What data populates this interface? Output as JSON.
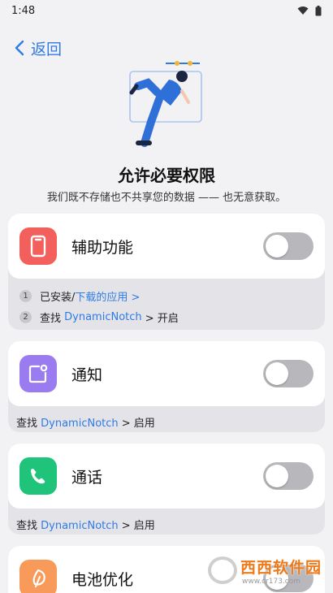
{
  "status": {
    "time": "1:48"
  },
  "nav": {
    "back_label": "返回"
  },
  "header": {
    "title": "允许必要权限",
    "subtitle": "我们既不存储也不共享您的数据 —— 也无意获取。"
  },
  "accessibility": {
    "label": "辅助功能",
    "enabled": false,
    "steps": [
      {
        "num": "1",
        "prefix": "已安装/",
        "link": "下载的应用 >",
        "suffix": ""
      },
      {
        "num": "2",
        "prefix": "查找 ",
        "link": "DynamicNotch",
        "suffix": " > 开启"
      }
    ]
  },
  "notification": {
    "label": "通知",
    "enabled": false,
    "hint": {
      "prefix": "查找 ",
      "link": "DynamicNotch",
      "suffix": " > 启用"
    }
  },
  "call": {
    "label": "通话",
    "enabled": false,
    "hint": {
      "prefix": "查找 ",
      "link": "DynamicNotch",
      "suffix": " > 启用"
    }
  },
  "battery": {
    "label": "电池优化",
    "enabled": false
  },
  "watermark": {
    "text": "西西软件园",
    "sub": "www.cr173.com"
  },
  "colors": {
    "accent": "#2f7be5",
    "accessibility_icon": "#f25f5c",
    "notification_icon": "#9b7cf0",
    "call_icon": "#1fc47a",
    "battery_icon": "#f79a5a"
  }
}
